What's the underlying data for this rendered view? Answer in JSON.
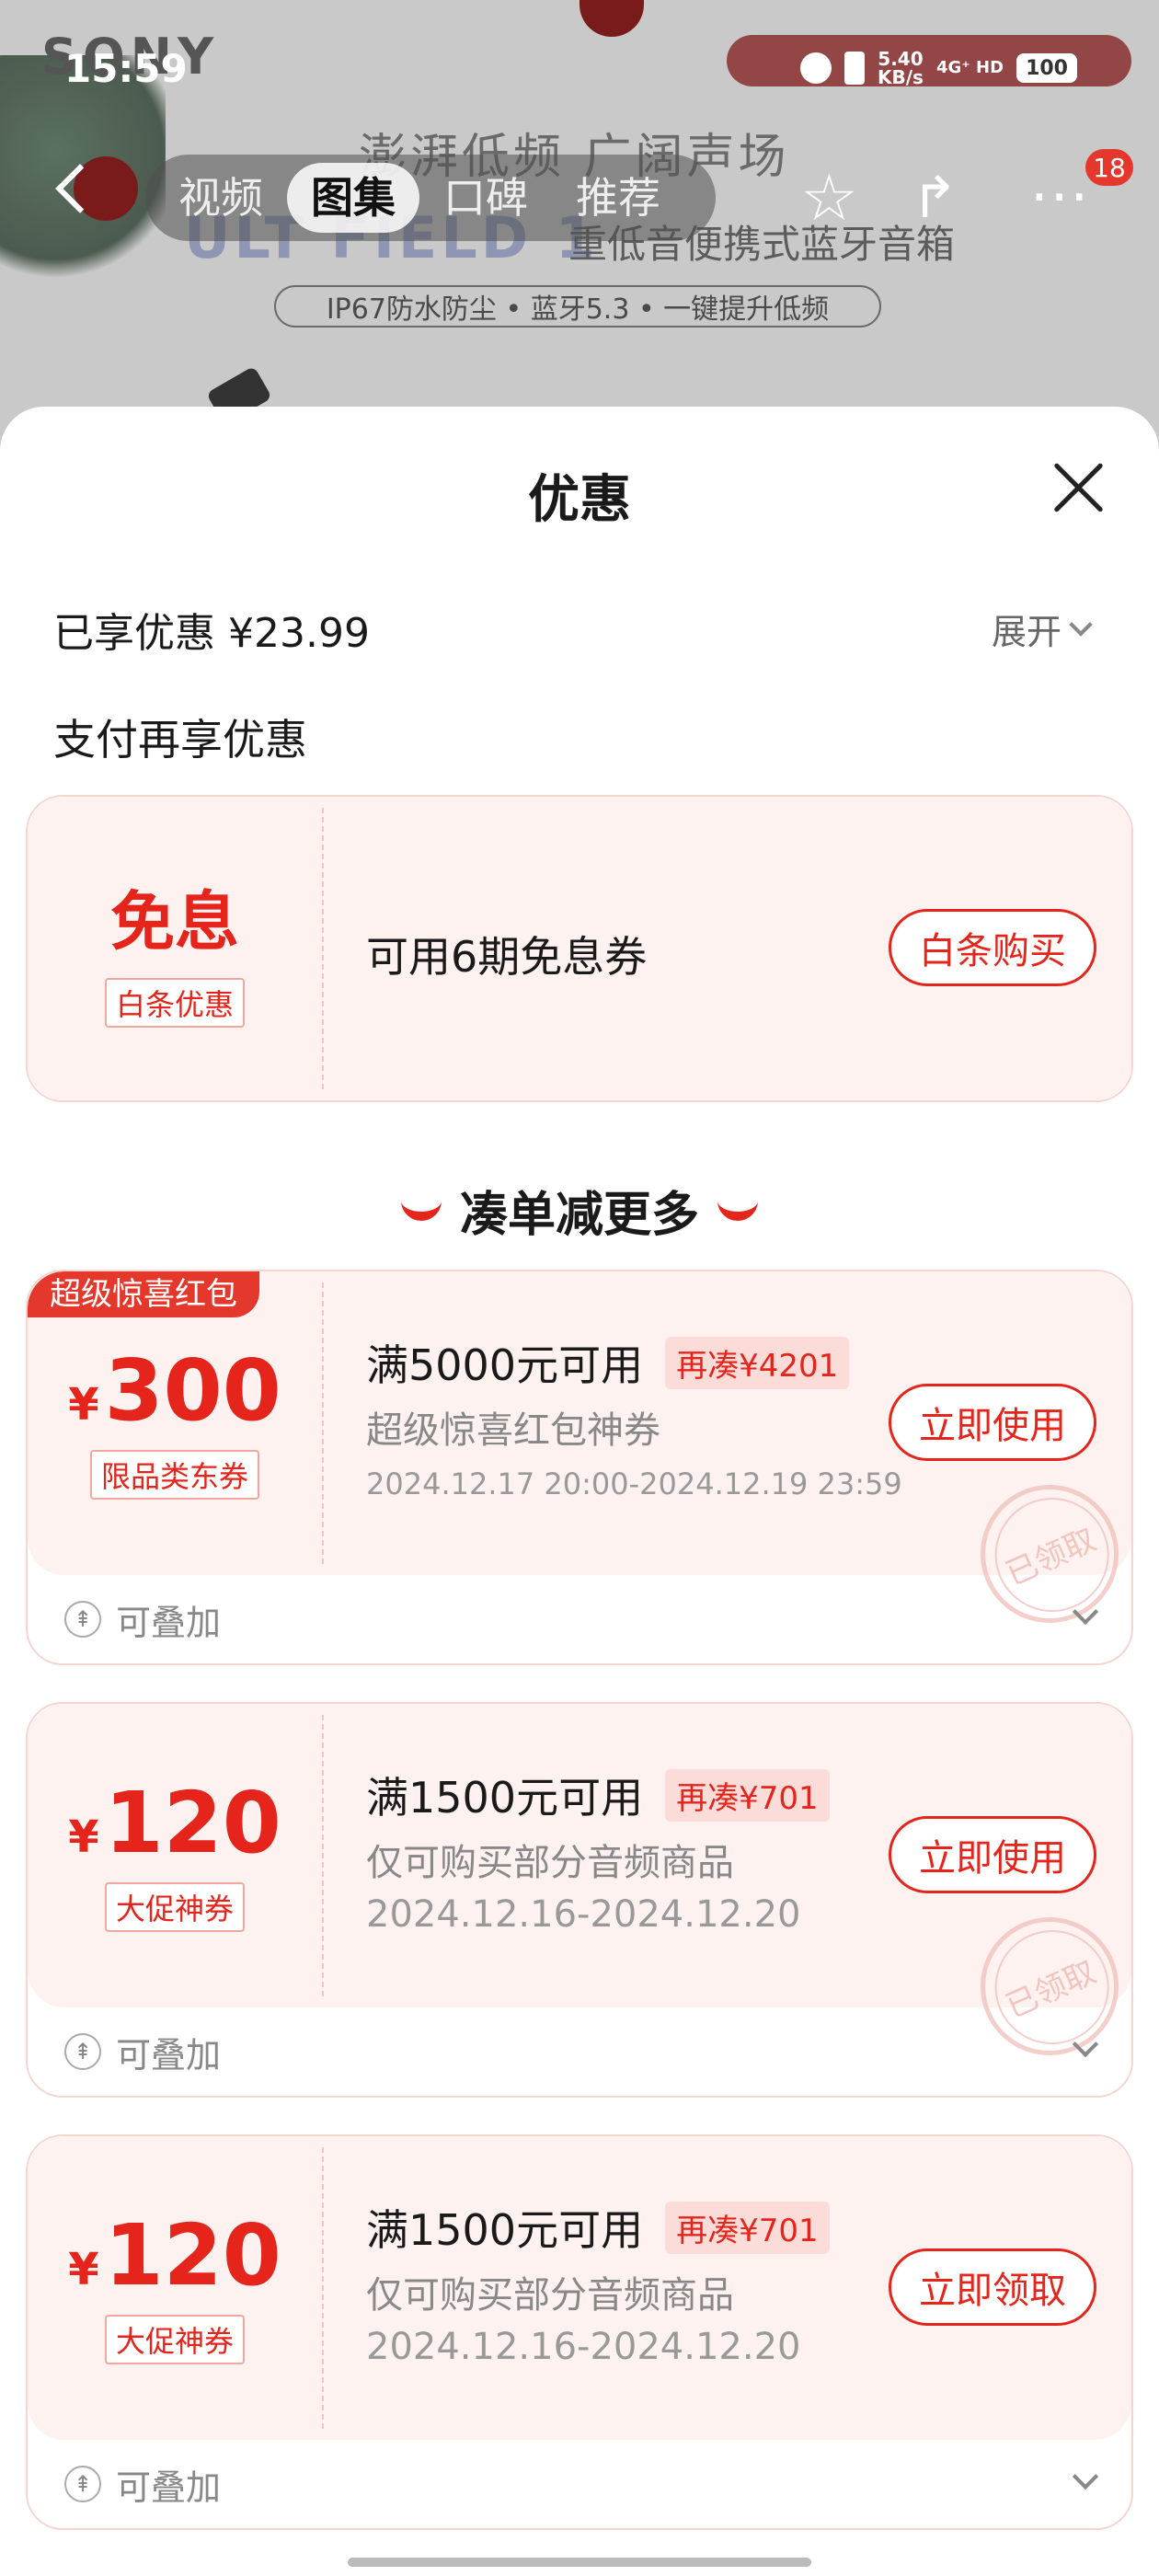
{
  "status_bar": {
    "time": "15:59",
    "speed_value": "5.40",
    "speed_unit": "KB/s",
    "network": "4G⁺ HD",
    "battery": "100"
  },
  "background_page": {
    "brand": "SONY",
    "headline": "澎湃低频 广阔声场",
    "ghost_model": "ULT FIELD 1",
    "subhead": "重低音便携式蓝牙音箱",
    "features": "IP67防水防尘 • 蓝牙5.3 • 一键提升低频"
  },
  "nav": {
    "tabs": [
      "视频",
      "图集",
      "口碑",
      "推荐"
    ],
    "active_tab": "图集",
    "more_badge": "18"
  },
  "sheet": {
    "title": "优惠",
    "enjoyed": "已享优惠 ¥23.99",
    "expand_label": "展开",
    "pay_title": "支付再享优惠",
    "baitiao": {
      "big_label": "免息",
      "tag": "白条优惠",
      "text": "可用6期免息券",
      "button": "白条购买"
    },
    "more_title": "凑单减更多",
    "coupons": [
      {
        "ribbon": "超级惊喜红包",
        "currency": "¥",
        "amount": "300",
        "tag": "限品类东券",
        "condition": "满5000元可用",
        "extra": "再凑¥4201",
        "desc": "超级惊喜红包神券",
        "date": "2024.12.17 20:00-2024.12.19 23:59",
        "button": "立即使用",
        "stamp": "已领取",
        "stack_label": "可叠加"
      },
      {
        "ribbon": "",
        "currency": "¥",
        "amount": "120",
        "tag": "大促神券",
        "condition": "满1500元可用",
        "extra": "再凑¥701",
        "desc": "仅可购买部分音频商品",
        "date": "2024.12.16-2024.12.20",
        "button": "立即使用",
        "stamp": "已领取",
        "stack_label": "可叠加"
      },
      {
        "ribbon": "",
        "currency": "¥",
        "amount": "120",
        "tag": "大促神券",
        "condition": "满1500元可用",
        "extra": "再凑¥701",
        "desc": "仅可购买部分音频商品",
        "date": "2024.12.16-2024.12.20",
        "button": "立即领取",
        "stamp": "",
        "stack_label": "可叠加"
      }
    ]
  },
  "colors": {
    "accent": "#e5241b",
    "card_bg": "#fdf2f0",
    "badge": "#e5382d"
  }
}
